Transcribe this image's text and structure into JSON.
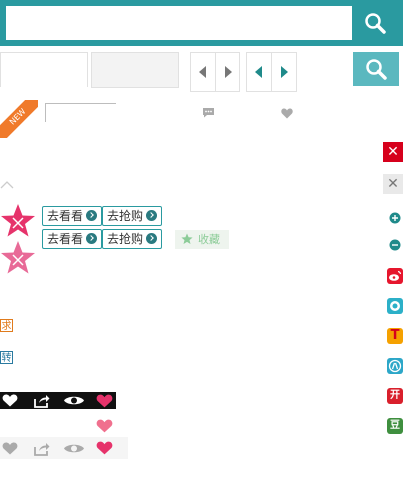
{
  "search": {
    "value": "",
    "placeholder": ""
  },
  "tabs": [
    {
      "label": ""
    },
    {
      "label": ""
    }
  ],
  "ribbon": {
    "label": "NEW"
  },
  "actions": [
    {
      "label": "去看看"
    },
    {
      "label": "去抢购"
    },
    {
      "label": "去看看"
    },
    {
      "label": "去抢购"
    }
  ],
  "favorite": {
    "label": "收藏"
  },
  "side_tags": [
    {
      "label": "求",
      "color": "#e07b1d"
    },
    {
      "label": "转",
      "color": "#2a7aa0"
    }
  ],
  "share_buttons": [
    {
      "name": "plus",
      "color": "#1f8a8a"
    },
    {
      "name": "minus",
      "color": "#1f8a8a"
    },
    {
      "name": "weibo",
      "color": "#e6162d",
      "label": ""
    },
    {
      "name": "qzone",
      "color": "#2cb0c8",
      "label": ""
    },
    {
      "name": "tqq",
      "color": "#f5a100",
      "label": "T"
    },
    {
      "name": "renren",
      "color": "#2da7c8",
      "label": ""
    },
    {
      "name": "kaixin",
      "color": "#d9202c",
      "label": "开"
    },
    {
      "name": "douban",
      "color": "#3f8f3f",
      "label": "豆"
    }
  ],
  "colors": {
    "accent": "#2a9aa0",
    "accent_light": "#5bb8bf",
    "close_red": "#d6001c",
    "star_pink": "#e6336b",
    "star_light_pink": "#e86a97",
    "heart": "#e6336b"
  }
}
